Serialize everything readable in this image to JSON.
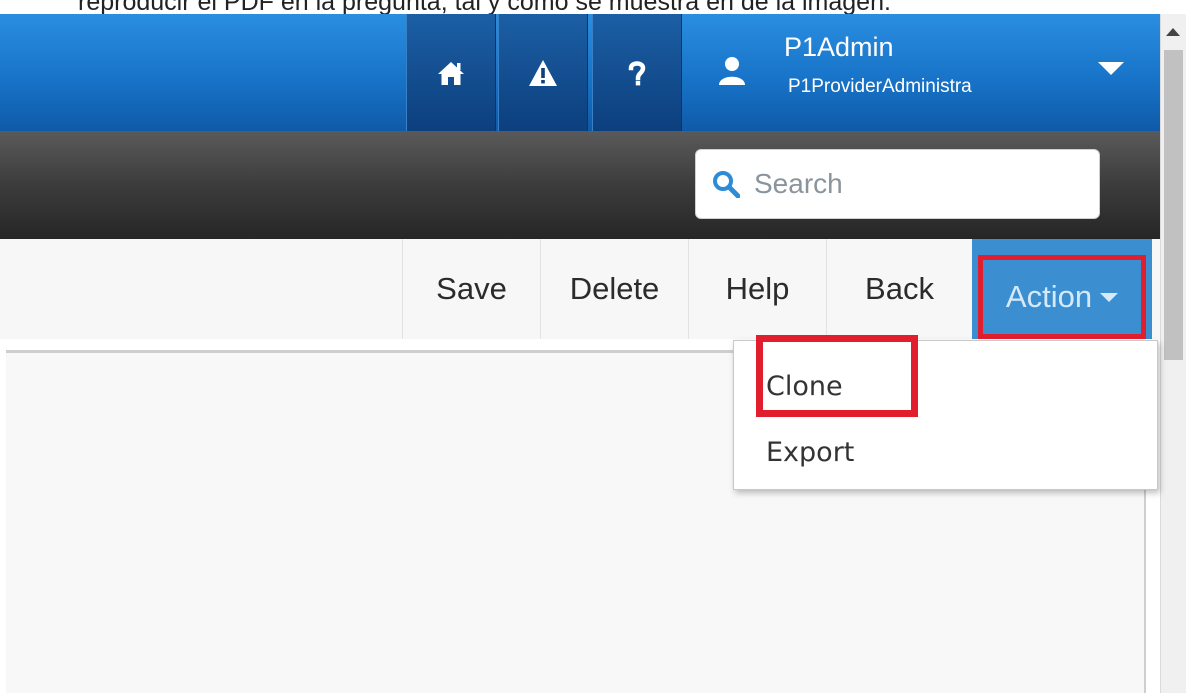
{
  "caption": {
    "text": "reproducir el PDF en la pregunta, tal y como se muestra en de la imagen."
  },
  "topbar": {
    "icons": [
      "home-icon",
      "warning-icon",
      "help-icon",
      "user-icon",
      "chevron-down-icon"
    ],
    "user": {
      "name": "P1Admin",
      "role": "P1ProviderAdministra"
    }
  },
  "search": {
    "placeholder": "Search"
  },
  "toolbar": {
    "save": "Save",
    "delete": "Delete",
    "help": "Help",
    "back": "Back",
    "action": "Action"
  },
  "action_menu": {
    "items": [
      {
        "label": "Clone"
      },
      {
        "label": "Export"
      }
    ]
  },
  "colors": {
    "topbar_blue": "#1874c8",
    "icon_button_dark": "#0c3f7d",
    "searchbar_dark": "#3c3c3c",
    "action_blue": "#3b8fd1",
    "highlight_red": "#e01e2e"
  }
}
